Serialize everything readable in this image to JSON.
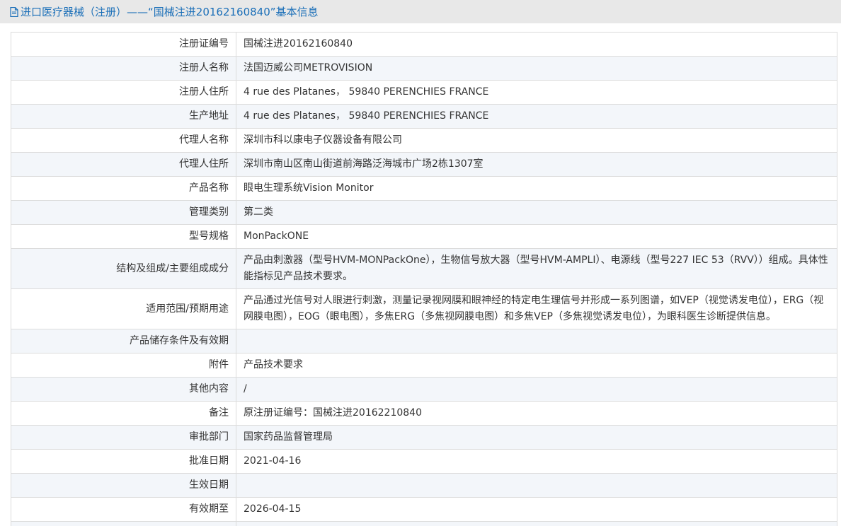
{
  "header": {
    "icon": "document-icon",
    "title": "进口医疗器械（注册）——“国械注进20162160840”基本信息"
  },
  "rows": [
    {
      "label": "注册证编号",
      "value": "国械注进20162160840"
    },
    {
      "label": "注册人名称",
      "value": "法国迈威公司METROVISION"
    },
    {
      "label": "注册人住所",
      "value": "4 rue des Platanes， 59840 PERENCHIES FRANCE"
    },
    {
      "label": "生产地址",
      "value": "4 rue des Platanes， 59840 PERENCHIES FRANCE"
    },
    {
      "label": "代理人名称",
      "value": "深圳市科以康电子仪器设备有限公司"
    },
    {
      "label": "代理人住所",
      "value": "深圳市南山区南山街道前海路泛海城市广场2栋1307室"
    },
    {
      "label": "产品名称",
      "value": "眼电生理系统Vision Monitor"
    },
    {
      "label": "管理类别",
      "value": "第二类"
    },
    {
      "label": "型号规格",
      "value": "MonPackONE"
    },
    {
      "label": "结构及组成/主要组成成分",
      "value": "产品由刺激器（型号HVM-MONPackOne），生物信号放大器（型号HVM-AMPLI）、电源线（型号227 IEC 53（RVV））组成。具体性能指标见产品技术要求。"
    },
    {
      "label": "适用范围/预期用途",
      "value": "产品通过光信号对人眼进行刺激，测量记录视网膜和眼神经的特定电生理信号并形成一系列图谱，如VEP（视觉诱发电位），ERG（视网膜电图），EOG（眼电图），多焦ERG（多焦视网膜电图）和多焦VEP（多焦视觉诱发电位），为眼科医生诊断提供信息。"
    },
    {
      "label": "产品储存条件及有效期",
      "value": ""
    },
    {
      "label": "附件",
      "value": "产品技术要求"
    },
    {
      "label": "其他内容",
      "value": "/"
    },
    {
      "label": "备注",
      "value": "原注册证编号：国械注进20162210840"
    },
    {
      "label": "审批部门",
      "value": "国家药品监督管理局"
    },
    {
      "label": "批准日期",
      "value": "2021-04-16"
    },
    {
      "label": "生效日期",
      "value": ""
    },
    {
      "label": "有效期至",
      "value": "2026-04-15"
    },
    {
      "label": "",
      "value": ""
    }
  ],
  "colors": {
    "header_bg": "#e8e8e8",
    "title": "#1b6fb8",
    "stripe": "#f3f6fa",
    "border": "#dcdcdc"
  }
}
